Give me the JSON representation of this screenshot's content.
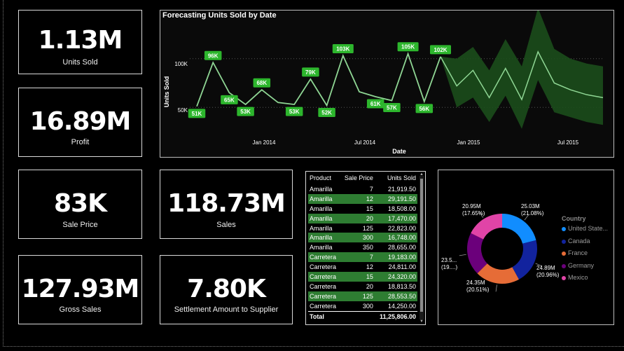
{
  "kpis": [
    {
      "value": "1.13M",
      "label": "Units Sold"
    },
    {
      "value": "16.89M",
      "label": "Profit"
    },
    {
      "value": "83K",
      "label": "Sale Price"
    },
    {
      "value": "118.73M",
      "label": "Sales"
    },
    {
      "value": "127.93M",
      "label": "Gross Sales"
    },
    {
      "value": "7.80K",
      "label": "Settlement Amount to Supplier"
    }
  ],
  "forecast": {
    "title": "Forecasting Units Sold by Date",
    "ylabel": "Units Sold",
    "xlabel": "Date",
    "y_ticks": [
      "100K",
      "50K"
    ],
    "x_ticks": [
      "Jan 2014",
      "Jul 2014",
      "Jan 2015",
      "Jul 2015"
    ],
    "colors": {
      "line": "#8fd694",
      "label_bg": "#2db62d",
      "band": "#1b4d1b"
    }
  },
  "chart_data": [
    {
      "type": "line",
      "title": "Forecasting Units Sold by Date",
      "xlabel": "Date",
      "ylabel": "Units Sold",
      "ylim": [
        20000,
        135000
      ],
      "x": [
        "2013-09",
        "2013-10",
        "2013-11",
        "2013-12",
        "2014-01",
        "2014-02",
        "2014-03",
        "2014-04",
        "2014-05",
        "2014-06",
        "2014-07",
        "2014-08",
        "2014-09",
        "2014-10",
        "2014-11",
        "2014-12"
      ],
      "series": [
        {
          "values": [
            51000,
            96000,
            65000,
            53000,
            68000,
            55000,
            53000,
            79000,
            52000,
            103000,
            66000,
            61000,
            57000,
            105000,
            56000,
            102000
          ],
          "data_labels": [
            "51K",
            "96K",
            "65K",
            "53K",
            "68K",
            null,
            "53K",
            "79K",
            "52K",
            "103K",
            null,
            "61K",
            "57K",
            "105K",
            "56K",
            "102K"
          ]
        }
      ],
      "forecast": {
        "x": [
          "2014-12",
          "2015-01",
          "2015-02",
          "2015-03",
          "2015-04",
          "2015-05",
          "2015-06",
          "2015-07",
          "2015-08",
          "2015-09",
          "2015-10"
        ],
        "mean": [
          102000,
          72000,
          88000,
          60000,
          90000,
          58000,
          107000,
          75000,
          68000,
          63000,
          60000
        ],
        "upper": [
          102000,
          100000,
          112000,
          88000,
          120000,
          92000,
          152000,
          110000,
          100000,
          95000,
          92000
        ],
        "lower": [
          102000,
          50000,
          60000,
          35000,
          62000,
          28000,
          78000,
          45000,
          40000,
          35000,
          32000
        ]
      },
      "y_ticks": [
        "100K",
        "50K"
      ],
      "x_ticks": [
        "Jan 2014",
        "Jul 2014",
        "Jan 2015",
        "Jul 2015"
      ],
      "grid": true
    },
    {
      "type": "pie",
      "donut": true,
      "legend_title": "Country",
      "categories": [
        "United States of America",
        "Canada",
        "France",
        "Germany",
        "Mexico"
      ],
      "values": [
        25.03,
        24.89,
        24.35,
        23.5,
        20.95
      ],
      "percents": [
        21.08,
        20.96,
        20.51,
        null,
        17.65
      ],
      "value_labels": [
        "25.03M",
        "24.89M",
        "24.35M",
        "23.5...",
        "20.95M"
      ],
      "percent_labels": [
        "(21.08%)",
        "(20.96%)",
        "(20.51%)",
        "(19....)",
        "(17.65%)"
      ],
      "colors": [
        "#118dff",
        "#12239e",
        "#e66c37",
        "#6b007b",
        "#e044a7"
      ],
      "legend_placement": "right"
    }
  ],
  "table": {
    "headers": [
      "Product",
      "Sale Price",
      "Units Sold"
    ],
    "rows": [
      [
        "Amarilla",
        "7",
        "21,919.50"
      ],
      [
        "Amarilla",
        "12",
        "29,191.50"
      ],
      [
        "Amarilla",
        "15",
        "18,508.00"
      ],
      [
        "Amarilla",
        "20",
        "17,470.00"
      ],
      [
        "Amarilla",
        "125",
        "22,823.00"
      ],
      [
        "Amarilla",
        "300",
        "16,748.00"
      ],
      [
        "Amarilla",
        "350",
        "28,655.00"
      ],
      [
        "Carretera",
        "7",
        "19,183.00"
      ],
      [
        "Carretera",
        "12",
        "24,811.00"
      ],
      [
        "Carretera",
        "15",
        "24,320.00"
      ],
      [
        "Carretera",
        "20",
        "18,813.50"
      ],
      [
        "Carretera",
        "125",
        "28,553.50"
      ],
      [
        "Carretera",
        "300",
        "14,250.00"
      ]
    ],
    "total_label": "Total",
    "total_value": "11,25,806.00"
  },
  "donut": {
    "legend_title": "Country",
    "legend": [
      "United State...",
      "Canada",
      "France",
      "Germany",
      "Mexico"
    ]
  }
}
